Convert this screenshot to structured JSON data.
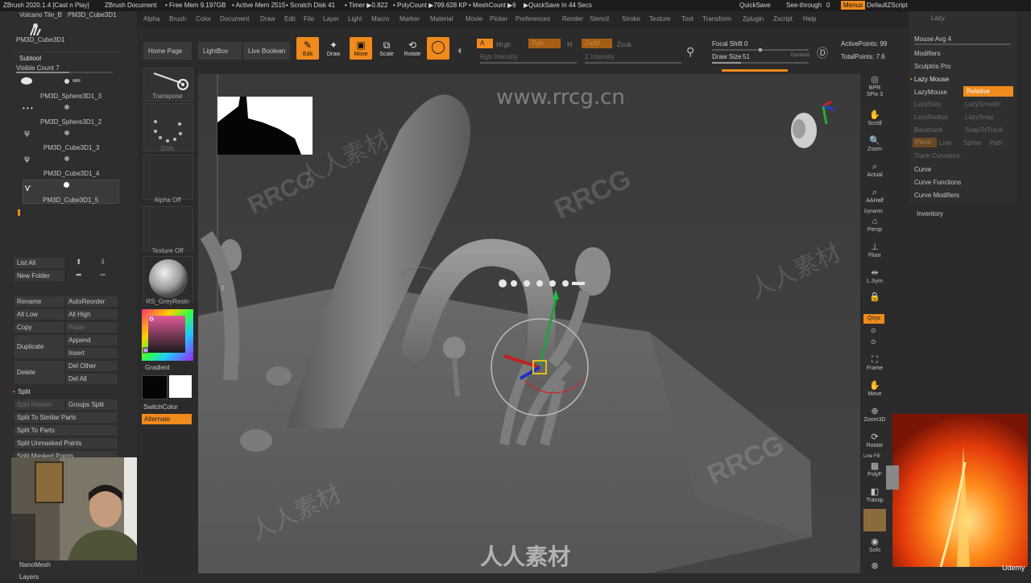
{
  "status": {
    "app": "ZBrush 2020.1.4 [Cast n Play]",
    "document": "ZBrush Document",
    "free_mem": "• Free Mem 9.197GB",
    "active_mem": "• Active Mem 2515",
    "scratch": "• Scratch Disk 41",
    "timer": "• Timer ▶0.822",
    "polycount": "• PolyCount ▶799.628 KP",
    "meshcount": "• MeshCount ▶6",
    "quicksave_in": "▶QuickSave In 44 Secs",
    "quicksave": "QuickSave",
    "see_through": "See-through",
    "see_through_value": "0",
    "menus": "Menus",
    "script": "DefaultZScript"
  },
  "menu": [
    "Alpha",
    "Brush",
    "Color",
    "Document",
    "Draw",
    "Edit",
    "File",
    "Layer",
    "Light",
    "Macro",
    "Marker",
    "Material",
    "Movie",
    "Picker",
    "Preferences",
    "Render",
    "Stencil",
    "Stroke",
    "Texture",
    "Tool",
    "Transform",
    "Zplugin",
    "Zscript",
    "Help"
  ],
  "left": {
    "tool_name": "Volcano Tile_B",
    "tool_name2": "PM3D_Cube3D1",
    "tool_thumb_label": "PM3D_Cube3D1",
    "subtool_header": "Subtool",
    "visible_count": "Visible Count 7",
    "subtools": [
      "PM3D_Sphere3D1_3",
      "PM3D_Sphere3D1_2",
      "PM3D_Cube3D1_3",
      "PM3D_Cube3D1_4",
      "PM3D_Cube3D1_5"
    ],
    "list_all": "List All",
    "new_folder": "New Folder",
    "rename": "Rename",
    "auto_reorder": "AutoReorder",
    "all_low": "All Low",
    "all_high": "All High",
    "copy": "Copy",
    "paste": "Paste",
    "duplicate": "Duplicate",
    "append": "Append",
    "insert": "Insert",
    "delete": "Delete",
    "del_other": "Del Other",
    "del_all": "Del All",
    "split": "Split",
    "split_hidden": "Split Hidden",
    "groups_split": "Groups Split",
    "split_similar": "Split To Similar Parts",
    "split_parts": "Split To Parts",
    "split_unmasked": "Split Unmasked Points",
    "split_masked": "Split Masked Points",
    "nanomesh": "NanoMesh",
    "layers": "Layers"
  },
  "toolcol": {
    "home": "Home Page",
    "lightbox": "LightBox",
    "live_boolean": "Live Boolean",
    "transpose": "Transpose",
    "dots": "Dots",
    "alpha_off": "Alpha Off",
    "texture_off": "Texture Off",
    "material": "RS_GreyResin",
    "gradient": "Gradient",
    "switch_color": "SwitchColor",
    "alternate": "Alternate"
  },
  "shelf": {
    "edit": "Edit",
    "draw": "Draw",
    "move": "Move",
    "scale": "Scale",
    "rotate": "Rotate",
    "a_label": "A",
    "mrgb": "Mrgb",
    "rgb": "Rgb",
    "m": "M",
    "zadd": "Zadd",
    "zsub": "Zsub",
    "rgb_intensity": "Rgb Intensity",
    "z_intensity": "Z Intensity",
    "focal_shift_label": "Focal Shift",
    "focal_shift": "0",
    "draw_size_label": "Draw Size",
    "draw_size": "51",
    "dynamic": "Dynamic",
    "active_points": "ActivePoints: 99",
    "total_points": "TotalPoints: 7.6"
  },
  "rightshelf": [
    "BPR",
    "SPix 3",
    "Scroll",
    "Zoom",
    "Actual",
    "AAHalf",
    "Persp",
    "Floor",
    "L.Sym",
    "",
    "Qxyz",
    "",
    "",
    "Frame",
    "Move",
    "Zoom3D",
    "Rotate",
    "PolyF",
    "Transp",
    "",
    "Solo",
    "Xpose"
  ],
  "rightshelf_dynamic": "Dynamic",
  "rightshelf_linefill": "Line Fill",
  "right": {
    "lazy": "Lazy",
    "mouse_avg": "Mouse Avg 4",
    "modifiers": "Modifiers",
    "sculptris": "Sculptris Pro",
    "lazy_mouse": "Lazy Mouse",
    "lazymouse_btn": "LazyMouse",
    "relative": "Relative",
    "lazystep": "LazyStep",
    "lazysmooth": "LazySmooth",
    "lazyradius": "LazyRadius",
    "lazysnap": "LazySnap",
    "backtrack": "Backtrack",
    "snaptotrack": "SnapToTrack",
    "plane": "Plane",
    "line": "Line",
    "spline": "Spline",
    "path": "Path",
    "track_curvature": "Track Curvature",
    "curve": "Curve",
    "curve_functions": "Curve Functions",
    "curve_modifiers": "Curve Modifiers",
    "inventory": "Inventory"
  },
  "watermarks": {
    "site": "www.rrcg.cn",
    "brand": "RRCG",
    "cn": "人人素材",
    "udemy": "Udemy"
  },
  "colors": {
    "accent": "#f08a1c",
    "panel": "#2e2e2e",
    "viewport": "#3e3e3e"
  }
}
